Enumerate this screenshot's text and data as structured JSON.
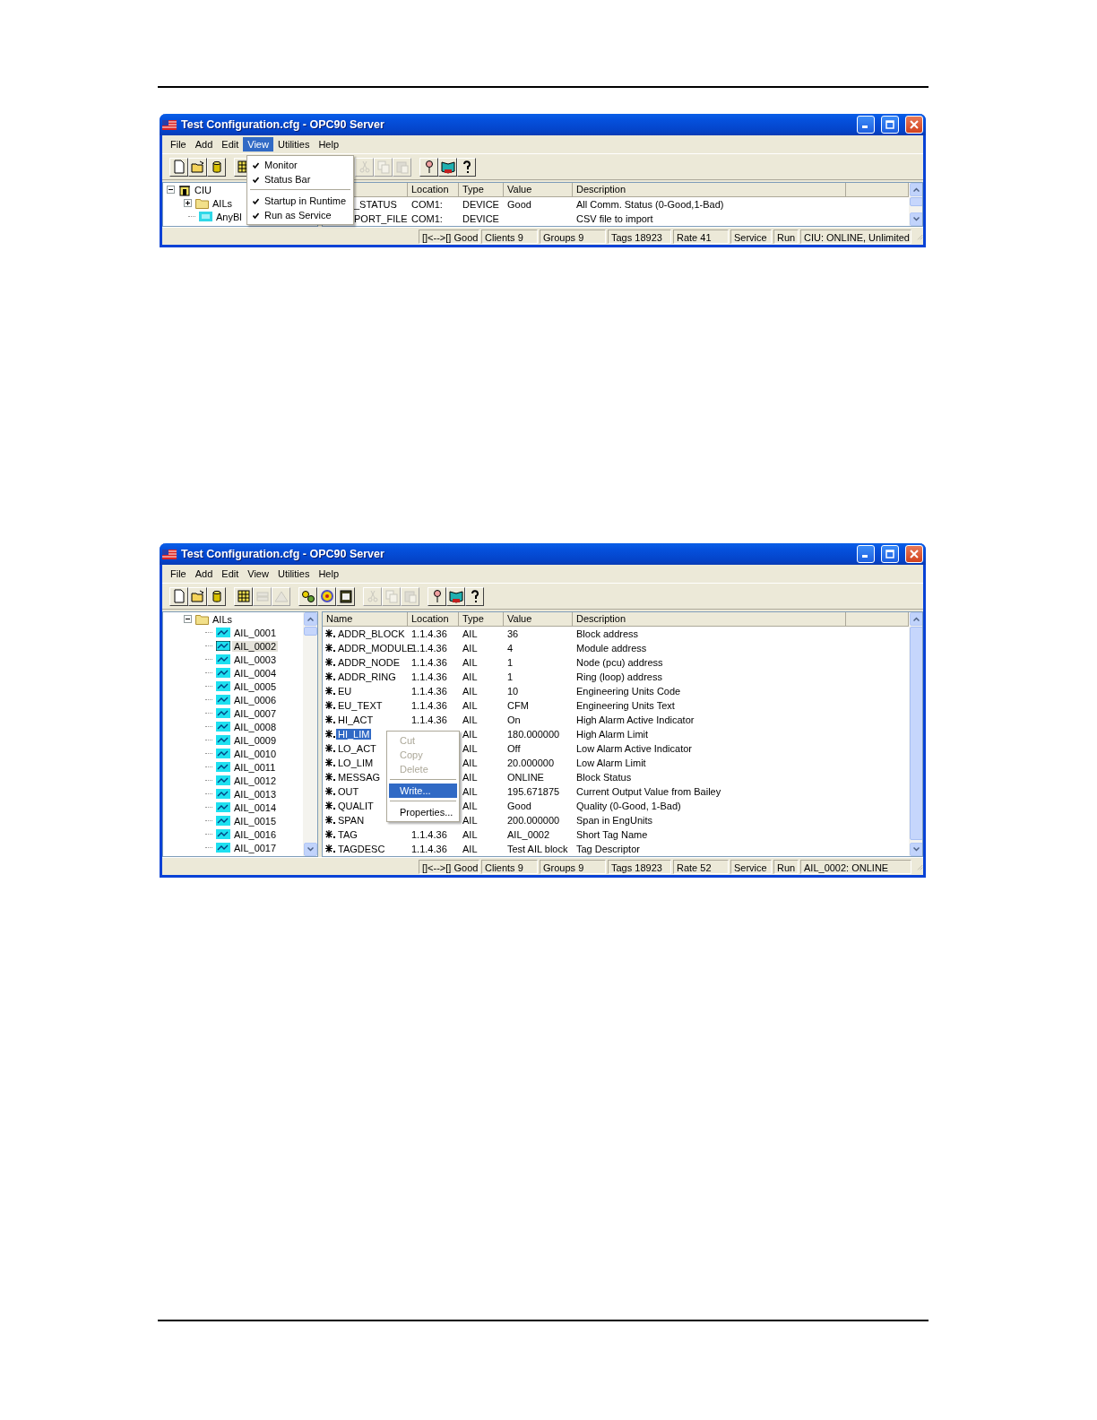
{
  "windows": [
    {
      "title": "Test Configuration.cfg - OPC90 Server",
      "menu": [
        {
          "label": "File",
          "selected": false
        },
        {
          "label": "Add",
          "selected": false
        },
        {
          "label": "Edit",
          "selected": false
        },
        {
          "label": "View",
          "selected": true
        },
        {
          "label": "Utilities",
          "selected": false
        },
        {
          "label": "Help",
          "selected": false
        }
      ],
      "dropdown": {
        "items": [
          {
            "kind": "item",
            "label": "Monitor",
            "checked": true
          },
          {
            "kind": "item",
            "label": "Status Bar",
            "checked": true
          },
          {
            "kind": "separator"
          },
          {
            "kind": "item",
            "label": "Startup in Runtime",
            "checked": true
          },
          {
            "kind": "item",
            "label": "Run as Service",
            "checked": true
          }
        ]
      },
      "toolbar": [
        {
          "kind": "new",
          "disabled": false
        },
        {
          "kind": "open",
          "disabled": false
        },
        {
          "kind": "database",
          "disabled": false
        },
        {
          "kind": "separator"
        },
        {
          "kind": "grid",
          "disabled": false
        },
        {
          "kind": "gap"
        },
        {
          "kind": "cut",
          "disabled": true
        },
        {
          "kind": "copy",
          "disabled": true
        },
        {
          "kind": "paste",
          "disabled": true
        },
        {
          "kind": "separator"
        },
        {
          "kind": "pin",
          "disabled": false
        },
        {
          "kind": "book",
          "disabled": false
        },
        {
          "kind": "help",
          "disabled": false
        }
      ],
      "tree": [
        {
          "label": "CIU",
          "kind": "root",
          "expanded": true,
          "selected": false,
          "children": [
            {
              "label": "AILs",
              "kind": "folder",
              "expanded": false,
              "selected": false
            },
            {
              "label": "AnyBl",
              "kind": "block",
              "selected": false
            }
          ]
        }
      ],
      "table": {
        "name_header_covered": true,
        "columns": [
          "Location",
          "Type",
          "Value",
          "Description"
        ],
        "rows": [
          {
            "name": "_STATUS",
            "location": "COM1:",
            "type": "DEVICE",
            "value": "Good",
            "description": "All Comm. Status (0-Good,1-Bad)",
            "selected": false
          },
          {
            "name": "PORT_FILE",
            "location": "COM1:",
            "type": "DEVICE",
            "description": "CSV file to import",
            "selected": false
          }
        ]
      },
      "status_bar": [
        "[]<-->[] Good",
        "Clients 9",
        "Groups 9",
        "Tags 18923",
        "Rate 41",
        "Service",
        "Run",
        "CIU: ONLINE, Unlimited"
      ]
    },
    {
      "title": "Test Configuration.cfg - OPC90 Server",
      "menu": [
        {
          "label": "File",
          "selected": false
        },
        {
          "label": "Add",
          "selected": false
        },
        {
          "label": "Edit",
          "selected": false
        },
        {
          "label": "View",
          "selected": false
        },
        {
          "label": "Utilities",
          "selected": false
        },
        {
          "label": "Help",
          "selected": false
        }
      ],
      "toolbar": [
        {
          "kind": "new",
          "disabled": false
        },
        {
          "kind": "open",
          "disabled": false
        },
        {
          "kind": "database",
          "disabled": false
        },
        {
          "kind": "separator"
        },
        {
          "kind": "grid",
          "disabled": false
        },
        {
          "kind": "stack",
          "disabled": true
        },
        {
          "kind": "mountain",
          "disabled": true
        },
        {
          "kind": "separator"
        },
        {
          "kind": "gears",
          "disabled": false
        },
        {
          "kind": "refresh",
          "disabled": false
        },
        {
          "kind": "clipboard",
          "disabled": false
        },
        {
          "kind": "separator"
        },
        {
          "kind": "cut",
          "disabled": true
        },
        {
          "kind": "copy",
          "disabled": true
        },
        {
          "kind": "paste",
          "disabled": true
        },
        {
          "kind": "separator"
        },
        {
          "kind": "pin",
          "disabled": false
        },
        {
          "kind": "book",
          "disabled": false
        },
        {
          "kind": "help",
          "disabled": false
        }
      ],
      "tree": [
        {
          "label": "AILs",
          "kind": "folder",
          "expanded": true,
          "selected": false,
          "children": [
            {
              "label": "AIL_0001",
              "kind": "point",
              "selected": false
            },
            {
              "label": "AIL_0002",
              "kind": "point",
              "selected": true
            },
            {
              "label": "AIL_0003",
              "kind": "point",
              "selected": false
            },
            {
              "label": "AIL_0004",
              "kind": "point",
              "selected": false
            },
            {
              "label": "AIL_0005",
              "kind": "point",
              "selected": false
            },
            {
              "label": "AIL_0006",
              "kind": "point",
              "selected": false
            },
            {
              "label": "AIL_0007",
              "kind": "point",
              "selected": false
            },
            {
              "label": "AIL_0008",
              "kind": "point",
              "selected": false
            },
            {
              "label": "AIL_0009",
              "kind": "point",
              "selected": false
            },
            {
              "label": "AIL_0010",
              "kind": "point",
              "selected": false
            },
            {
              "label": "AIL_0011",
              "kind": "point",
              "selected": false
            },
            {
              "label": "AIL_0012",
              "kind": "point",
              "selected": false
            },
            {
              "label": "AIL_0013",
              "kind": "point",
              "selected": false
            },
            {
              "label": "AIL_0014",
              "kind": "point",
              "selected": false
            },
            {
              "label": "AIL_0015",
              "kind": "point",
              "selected": false
            },
            {
              "label": "AIL_0016",
              "kind": "point",
              "selected": false
            },
            {
              "label": "AIL_0017",
              "kind": "point",
              "selected": false
            }
          ]
        }
      ],
      "table": {
        "name_header_covered": false,
        "columns": [
          "Name",
          "Location",
          "Type",
          "Value",
          "Description"
        ],
        "rows": [
          {
            "name": "ADDR_BLOCK",
            "location": "1.1.4.36",
            "type": "AIL",
            "value": "36",
            "description": "Block address",
            "selected": false
          },
          {
            "name": "ADDR_MODULE",
            "location": "1.1.4.36",
            "type": "AIL",
            "value": "4",
            "description": "Module address",
            "selected": false
          },
          {
            "name": "ADDR_NODE",
            "location": "1.1.4.36",
            "type": "AIL",
            "value": "1",
            "description": "Node (pcu) address",
            "selected": false
          },
          {
            "name": "ADDR_RING",
            "location": "1.1.4.36",
            "type": "AIL",
            "value": "1",
            "description": "Ring (loop) address",
            "selected": false
          },
          {
            "name": "EU",
            "location": "1.1.4.36",
            "type": "AIL",
            "value": "10",
            "description": "Engineering Units Code",
            "selected": false
          },
          {
            "name": "EU_TEXT",
            "location": "1.1.4.36",
            "type": "AIL",
            "value": "CFM",
            "description": "Engineering Units Text",
            "selected": false
          },
          {
            "name": "HI_ACT",
            "location": "1.1.4.36",
            "type": "AIL",
            "value": "On",
            "description": "High Alarm Active Indicator",
            "selected": false
          },
          {
            "name": "HI_LIM",
            "type": "AIL",
            "value": "180.000000",
            "description": "High Alarm Limit",
            "selected": true
          },
          {
            "name": "LO_ACT",
            "type": "AIL",
            "value": "Off",
            "description": "Low Alarm Active Indicator",
            "selected": false
          },
          {
            "name": "LO_LIM",
            "type": "AIL",
            "value": "20.000000",
            "description": "Low Alarm Limit",
            "selected": false
          },
          {
            "name": "MESSAG",
            "type": "AIL",
            "value": "ONLINE",
            "description": "Block Status",
            "selected": false
          },
          {
            "name": "OUT",
            "type": "AIL",
            "value": "195.671875",
            "description": "Current Output Value from Bailey",
            "selected": false
          },
          {
            "name": "QUALIT",
            "type": "AIL",
            "value": "Good",
            "description": "Quality (0-Good, 1-Bad)",
            "selected": false
          },
          {
            "name": "SPAN",
            "type": "AIL",
            "value": "200.000000",
            "description": "Span in EngUnits",
            "selected": false
          },
          {
            "name": "TAG",
            "location": "1.1.4.36",
            "type": "AIL",
            "value": "AIL_0002",
            "description": "Short Tag Name",
            "selected": false
          },
          {
            "name": "TAGDESC",
            "location": "1.1.4.36",
            "type": "AIL",
            "value": "Test AIL block",
            "description": "Tag Descriptor",
            "selected": false
          }
        ]
      },
      "context_menu": {
        "items": [
          {
            "kind": "item",
            "label": "Cut",
            "disabled": true,
            "selected": false
          },
          {
            "kind": "item",
            "label": "Copy",
            "disabled": true,
            "selected": false
          },
          {
            "kind": "item",
            "label": "Delete",
            "disabled": true,
            "selected": false
          },
          {
            "kind": "separator"
          },
          {
            "kind": "item",
            "label": "Write...",
            "disabled": false,
            "selected": true
          },
          {
            "kind": "separator"
          },
          {
            "kind": "item",
            "label": "Properties...",
            "disabled": false,
            "selected": false
          }
        ]
      },
      "status_bar": [
        "[]<-->[] Good",
        "Clients 9",
        "Groups 9",
        "Tags 18923",
        "Rate 52",
        "Service",
        "Run",
        "AIL_0002: ONLINE"
      ]
    }
  ]
}
